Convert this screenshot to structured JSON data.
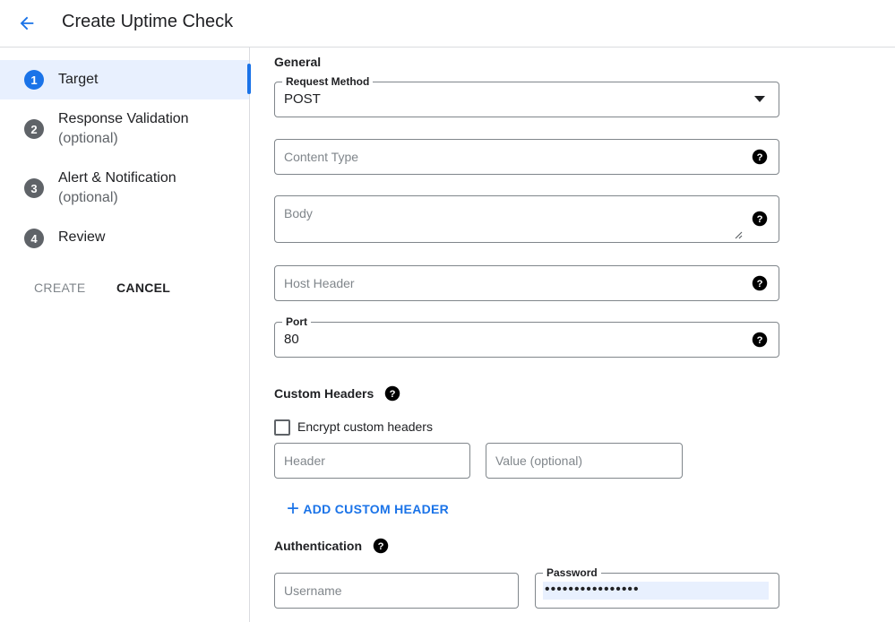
{
  "header": {
    "title": "Create Uptime Check",
    "back_icon": "arrow-back-icon"
  },
  "steps": [
    {
      "number": "1",
      "label": "Target",
      "sub": ""
    },
    {
      "number": "2",
      "label": "Response Validation",
      "sub": "(optional)"
    },
    {
      "number": "3",
      "label": "Alert & Notification",
      "sub": "(optional)"
    },
    {
      "number": "4",
      "label": "Review",
      "sub": ""
    }
  ],
  "actions": {
    "create_label": "CREATE",
    "cancel_label": "CANCEL"
  },
  "general": {
    "title": "General",
    "request_method": {
      "label": "Request Method",
      "value": "POST"
    },
    "content_type": {
      "placeholder": "Content Type"
    },
    "body": {
      "placeholder": "Body"
    },
    "host_header": {
      "placeholder": "Host Header"
    },
    "port": {
      "label": "Port",
      "value": "80"
    }
  },
  "custom_headers": {
    "title": "Custom Headers",
    "encrypt_label": "Encrypt custom headers",
    "encrypt_checked": false,
    "header_placeholder": "Header",
    "value_placeholder": "Value (optional)",
    "add_label": "ADD CUSTOM HEADER"
  },
  "authentication": {
    "title": "Authentication",
    "username_placeholder": "Username",
    "password_label": "Password",
    "password_value": "••••••••••••••••"
  },
  "colors": {
    "accent": "#1a73e8",
    "active_bg": "#e8f0fe",
    "border": "#80868b"
  }
}
